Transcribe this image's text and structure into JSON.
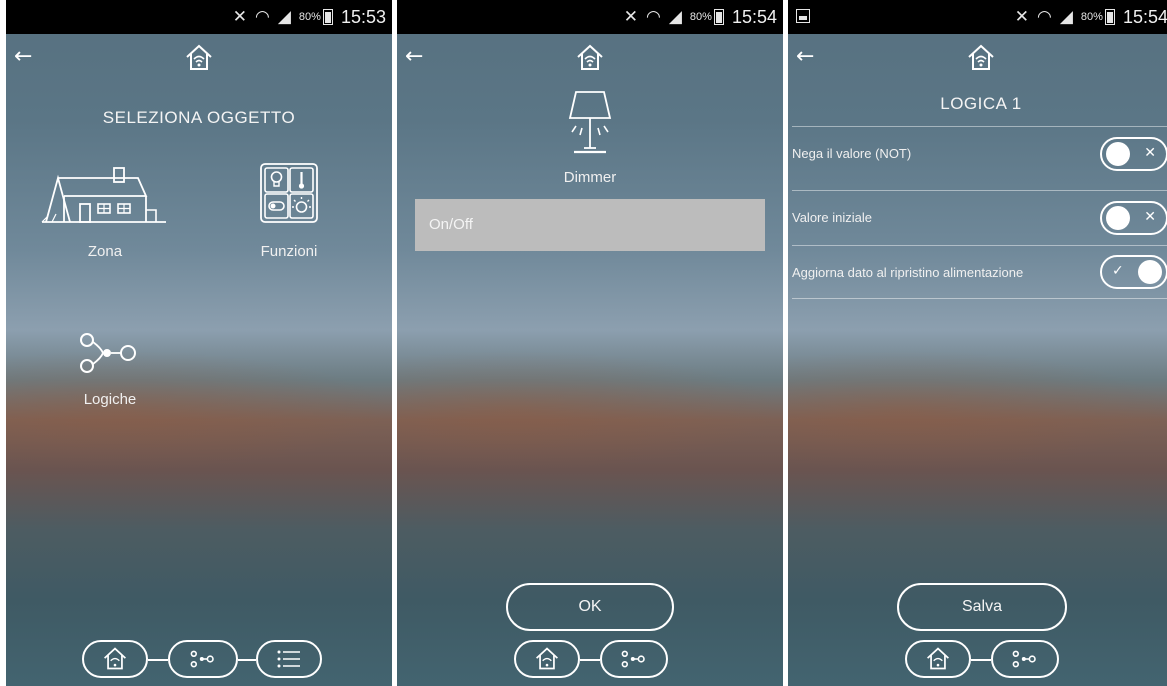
{
  "screens": [
    {
      "status": {
        "battery": "80%",
        "time": "15:53"
      },
      "title": "SELEZIONA OGGETTO",
      "tiles": [
        {
          "label": "Zona",
          "icon": "house-icon"
        },
        {
          "label": "Funzioni",
          "icon": "functions-icon"
        },
        {
          "label": "Logiche",
          "icon": "logic-icon"
        }
      ],
      "nav": [
        "home-icon",
        "logic-icon",
        "list-icon"
      ]
    },
    {
      "status": {
        "battery": "80%",
        "time": "15:54"
      },
      "object_label": "Dimmer",
      "object_icon": "lamp-icon",
      "selected_item": "On/Off",
      "ok_label": "OK",
      "nav": [
        "home-icon",
        "logic-icon"
      ]
    },
    {
      "status": {
        "battery": "80%",
        "time": "15:54"
      },
      "title": "LOGICA 1",
      "settings": [
        {
          "label": "Nega il valore (NOT)",
          "state": "off"
        },
        {
          "label": "Valore iniziale",
          "state": "off"
        },
        {
          "label": "Aggiorna dato al ripristino alimentazione",
          "state": "on"
        }
      ],
      "save_label": "Salva",
      "nav": [
        "home-icon",
        "logic-icon"
      ]
    }
  ],
  "colors": {
    "selected_row": "#bcbcbc",
    "status_bar": "#000000"
  }
}
